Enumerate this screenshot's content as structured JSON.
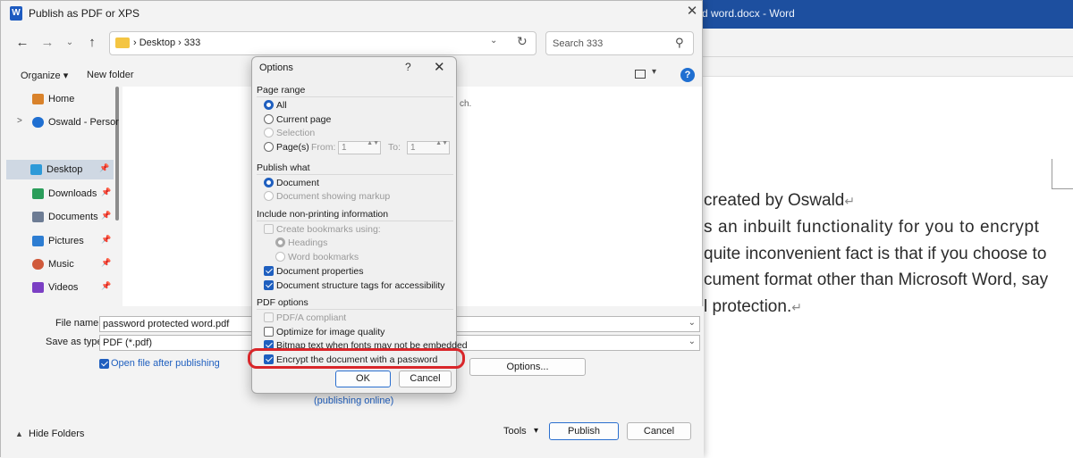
{
  "word": {
    "title": "d word.docx  -  Word",
    "doc_lines": [
      "created by Oswald",
      "s an inbuilt functionality for you to encrypt",
      "quite inconvenient fact is that if you choose to",
      "cument format other than Microsoft Word, say",
      "l protection."
    ],
    "paragraph_mark": "↵"
  },
  "publish_dialog": {
    "title": "Publish as PDF or XPS",
    "app_icon_letter": "W",
    "close_glyph": "✕",
    "nav": {
      "back": "←",
      "forward": "→",
      "dropdown": "⌄",
      "up": "↑"
    },
    "address": {
      "path": "›  Desktop  ›  333",
      "dropdown": "⌄",
      "refresh": "↻"
    },
    "search": {
      "placeholder": "Search 333",
      "icon": "⚲"
    },
    "toolbar": {
      "organize": "Organize ▾",
      "new_folder": "New folder",
      "view_dropdown": "▾",
      "help": "?"
    },
    "empty_folder_text": "ch.",
    "nav_items": [
      {
        "label": "Home",
        "icon": "home-icon",
        "color": "#d9822b"
      },
      {
        "label": "Oswald - Persor",
        "icon": "cloud-icon",
        "color": "#1f6fd1",
        "chevron": ">"
      },
      {
        "label": "Desktop",
        "icon": "desktop-icon",
        "color": "#2d9ad8",
        "pinned": true,
        "selected": true
      },
      {
        "label": "Downloads",
        "icon": "download-icon",
        "color": "#2a9d5a",
        "pinned": true
      },
      {
        "label": "Documents",
        "icon": "documents-icon",
        "color": "#6d7c94",
        "pinned": true
      },
      {
        "label": "Pictures",
        "icon": "pictures-icon",
        "color": "#2d7dd2",
        "pinned": true
      },
      {
        "label": "Music",
        "icon": "music-icon",
        "color": "#d05a3b",
        "pinned": true
      },
      {
        "label": "Videos",
        "icon": "videos-icon",
        "color": "#7b3fc4",
        "pinned": true
      }
    ],
    "pin_glyph": "📌",
    "file_name": {
      "label": "File name:",
      "value": "password protected word.pdf"
    },
    "save_as_type": {
      "label": "Save as type:",
      "value": "PDF (*.pdf)"
    },
    "open_after_publishing": {
      "label": "Open file after publishing",
      "checked": true
    },
    "options_button": "Options...",
    "publishing_online": "(publishing online)",
    "hide_folders": "Hide Folders",
    "hide_folders_glyph": "▲",
    "tools": "Tools",
    "tools_dropdown": "▾",
    "publish_button": "Publish",
    "cancel_button": "Cancel",
    "field_dropdown": "⌄"
  },
  "options_dialog": {
    "title": "Options",
    "help": "?",
    "close": "✕",
    "page_range": {
      "heading": "Page range",
      "all": "All",
      "current_page": "Current page",
      "selection": "Selection",
      "pages": "Page(s)",
      "from_label": "From:",
      "from_value": "1",
      "to_label": "To:",
      "to_value": "1",
      "spin_glyph": "▲▼"
    },
    "publish_what": {
      "heading": "Publish what",
      "document": "Document",
      "document_markup": "Document showing markup"
    },
    "non_printing": {
      "heading": "Include non-printing information",
      "create_bookmarks": "Create bookmarks using:",
      "headings": "Headings",
      "word_bookmarks": "Word bookmarks",
      "document_properties": "Document properties",
      "structure_tags": "Document structure tags for accessibility"
    },
    "pdf_options": {
      "heading": "PDF options",
      "pdfa": "PDF/A compliant",
      "optimize_image": "Optimize for image quality",
      "bitmap_text": "Bitmap text when fonts may not be embedded",
      "encrypt": "Encrypt the document with a password"
    },
    "ok_button": "OK",
    "cancel_button": "Cancel"
  },
  "colors": {
    "accent": "#1f5fbf",
    "highlight": "#d9262a",
    "word_blue": "#1d4f9f"
  }
}
